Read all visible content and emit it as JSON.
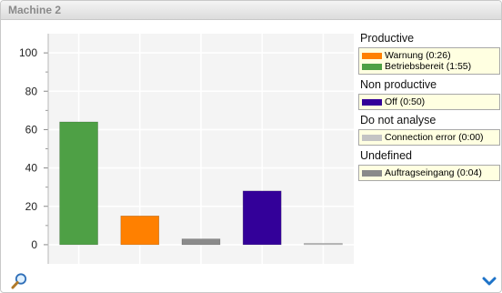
{
  "panel": {
    "title": "Machine 2"
  },
  "legend": {
    "groups": [
      {
        "title": "Productive",
        "items": [
          {
            "label": "Warnung (0:26)",
            "color": "#ff8000"
          },
          {
            "label": "Betriebsbereit (1:55)",
            "color": "#4ea045"
          }
        ]
      },
      {
        "title": "Non productive",
        "items": [
          {
            "label": "Off (0:50)",
            "color": "#330099"
          }
        ]
      },
      {
        "title": "Do not analyse",
        "items": [
          {
            "label": "Connection error (0:00)",
            "color": "#c4c4c4"
          }
        ]
      },
      {
        "title": "Undefined",
        "items": [
          {
            "label": "Auftragseingang (0:04)",
            "color": "#8a8a8a"
          }
        ]
      }
    ]
  },
  "icons": {
    "zoom": "magnifier-icon",
    "expand": "chevron-down-icon"
  },
  "chart_data": {
    "type": "bar",
    "categories": [
      "Betriebsbereit",
      "Warnung",
      "Auftragseingang",
      "Off",
      "Connection error"
    ],
    "values": [
      64,
      15,
      3,
      28,
      0
    ],
    "colors": [
      "#4ea045",
      "#ff8000",
      "#8a8a8a",
      "#330099",
      "#c4c4c4"
    ],
    "yticks": [
      0,
      20,
      40,
      60,
      80,
      100
    ],
    "ylim": [
      -10,
      110
    ],
    "grid": true
  }
}
